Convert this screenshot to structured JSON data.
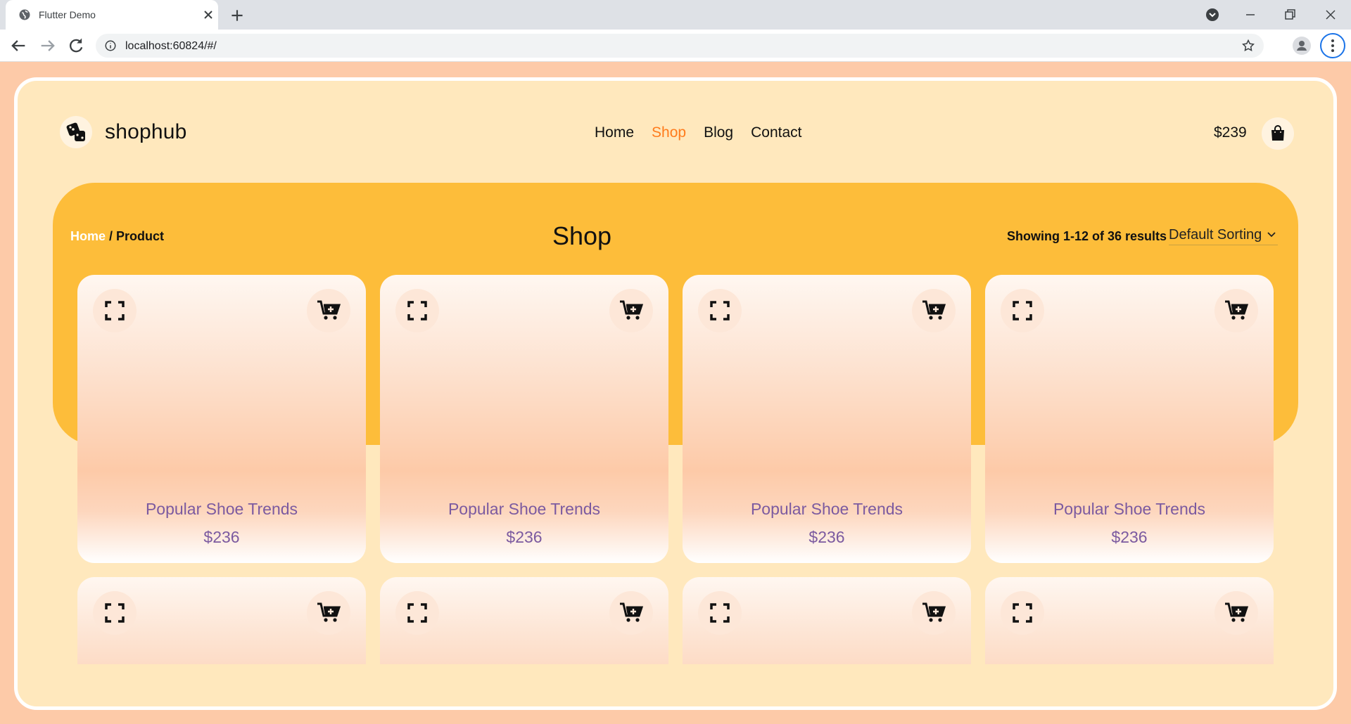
{
  "browser": {
    "tab_title": "Flutter Demo",
    "url": "localhost:60824/#/"
  },
  "header": {
    "logo_text": "shophub",
    "nav": [
      {
        "label": "Home",
        "active": false
      },
      {
        "label": "Shop",
        "active": true
      },
      {
        "label": "Blog",
        "active": false
      },
      {
        "label": "Contact",
        "active": false
      }
    ],
    "cart_total": "$239"
  },
  "hero": {
    "breadcrumb_home": "Home",
    "breadcrumb_rest": " / Product",
    "title": "Shop",
    "results_text": "Showing 1-12 of 36 results",
    "sorting_label": "Default Sorting"
  },
  "products": [
    {
      "title": "Popular Shoe Trends",
      "price": "$236"
    },
    {
      "title": "Popular Shoe Trends",
      "price": "$236"
    },
    {
      "title": "Popular Shoe Trends",
      "price": "$236"
    },
    {
      "title": "Popular Shoe Trends",
      "price": "$236"
    }
  ],
  "colors": {
    "page_bg": "#fdcaa8",
    "frame_bg": "#ffe8bd",
    "hero_bg": "#fdbd3a",
    "accent": "#ff7b1c",
    "product_text": "#7b5aa0"
  },
  "icons": {
    "expand": "fullscreen-icon",
    "cart": "add-to-cart-icon",
    "logo": "dice-icon",
    "bag": "shopping-bag-icon"
  }
}
